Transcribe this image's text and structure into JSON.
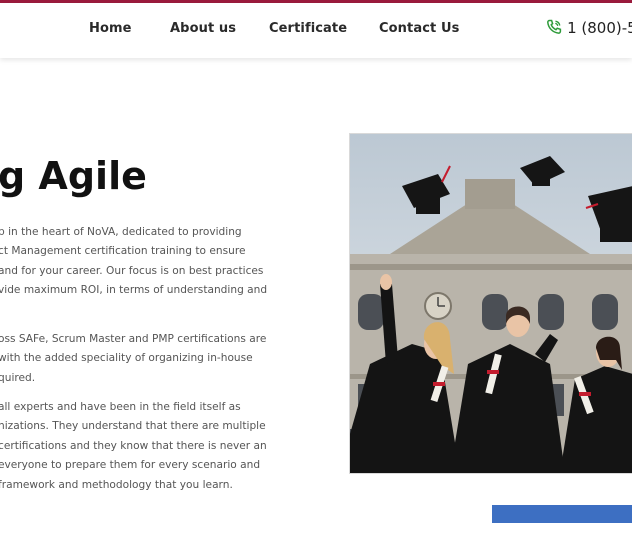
{
  "nav": {
    "items": [
      {
        "label": "Home"
      },
      {
        "label": "About us"
      },
      {
        "label": "Certificate"
      },
      {
        "label": "Contact Us"
      }
    ],
    "phone": "1 (800)-5",
    "phone_icon": "phone-icon"
  },
  "main": {
    "heading": "g Agile",
    "paragraphs": [
      "p in the heart of NoVA, dedicated to providing\nct Management certification training to ensure\nand for your career. Our focus is on best practices\nvide maximum ROI, in terms of understanding and",
      "oss SAFe, Scrum Master and PMP certifications are\nwith the added speciality of organizing in-house\nquired.",
      "all experts and have been in the field itself as\nnizations. They understand that there are multiple\ncertifications and they know that there is never an\neveryone to prepare them for every scenario and\nframework and methodology that you learn."
    ]
  },
  "colors": {
    "accent": "#9b1b3d",
    "cta": "#3d6fc2",
    "phone_icon": "#2e9b3a"
  }
}
